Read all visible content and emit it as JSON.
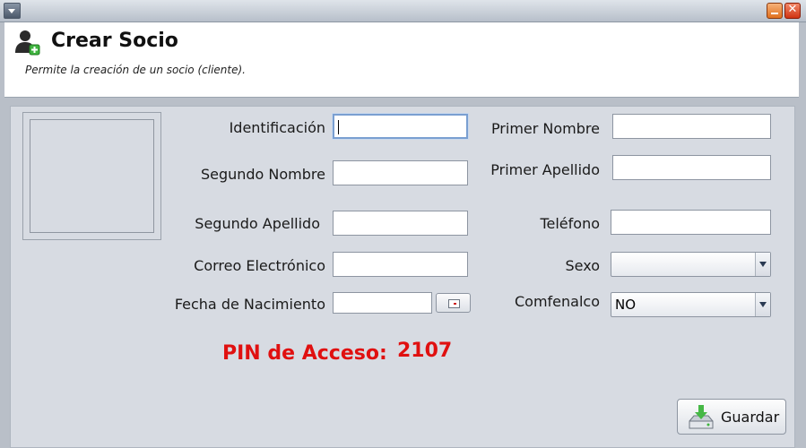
{
  "window": {
    "menu_icon": "chevron-down-icon",
    "minimize_icon": "minimize-icon",
    "close_icon": "close-icon",
    "close_glyph": "✕"
  },
  "header": {
    "icon": "add-user-icon",
    "title": "Crear Socio",
    "subtitle": "Permite la creación de un socio (cliente)."
  },
  "form": {
    "identificacion_label": "Identificación",
    "identificacion_value": "",
    "primer_nombre_label": "Primer Nombre",
    "primer_nombre_value": "",
    "segundo_nombre_label": "Segundo Nombre",
    "segundo_nombre_value": "",
    "primer_apellido_label": "Primer Apellido",
    "primer_apellido_value": "",
    "segundo_apellido_label": "Segundo Apellido",
    "segundo_apellido_value": "",
    "telefono_label": "Teléfono",
    "telefono_value": "",
    "correo_label": "Correo Electrónico",
    "correo_value": "",
    "sexo_label": "Sexo",
    "sexo_value": "",
    "fecha_label": "Fecha de Nacimiento",
    "fecha_value": "",
    "comfenalco_label": "Comfenalco",
    "comfenalco_value": "NO"
  },
  "pin": {
    "label": "PIN de Acceso:",
    "value": "2107",
    "color": "#e01010"
  },
  "actions": {
    "save_label": "Guardar",
    "save_icon": "download-drive-icon"
  }
}
